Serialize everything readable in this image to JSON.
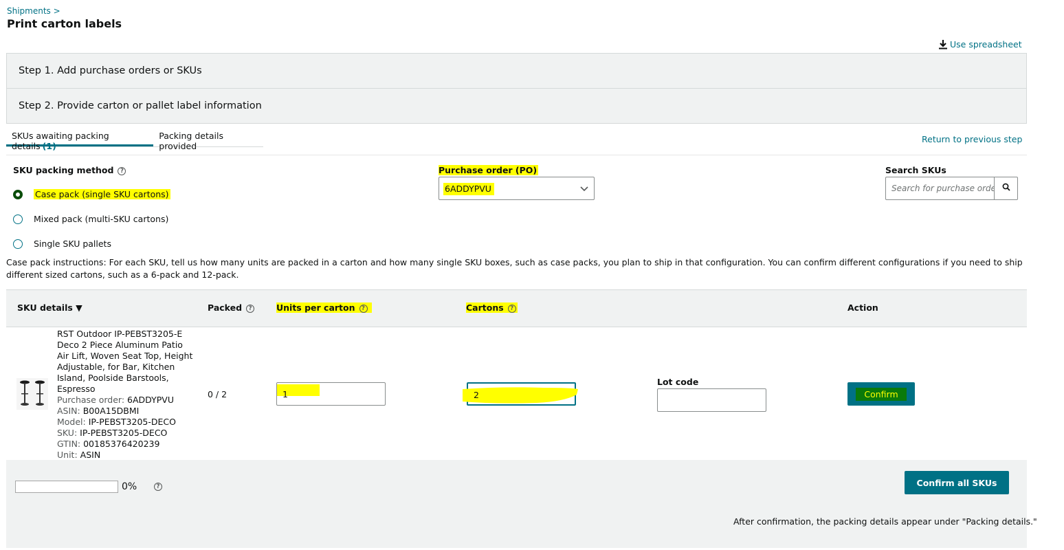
{
  "header": {
    "breadcrumb": "Shipments >",
    "title": "Print carton labels",
    "use_spreadsheet": "Use spreadsheet"
  },
  "steps": [
    {
      "title": "Step 1. Add purchase orders or SKUs"
    },
    {
      "title": "Step 2. Provide carton or pallet label information"
    }
  ],
  "tabs": [
    {
      "label": "SKUs awaiting packing details",
      "count": "(1)",
      "active": true
    },
    {
      "label": "Packing details provided",
      "active": false
    }
  ],
  "return_link": "Return to previous step",
  "packing_method": {
    "label": "SKU packing method",
    "options": [
      {
        "label": "Case pack (single SKU cartons)",
        "selected": true
      },
      {
        "label": "Mixed pack (multi-SKU cartons)",
        "selected": false
      },
      {
        "label": "Single SKU pallets",
        "selected": false
      }
    ]
  },
  "purchase_order": {
    "label": "Purchase order (PO)",
    "value": "6ADDYPVU"
  },
  "search": {
    "label": "Search SKUs",
    "placeholder": "Search for purchase orde"
  },
  "instructions": "Case pack instructions: For each SKU, tell us how many units are packed in a carton and how many single SKU boxes, such as case packs, you plan to ship in that configuration. You can confirm different configurations if you need to ship different sized cartons, such as a 6-pack and 12-pack.",
  "table": {
    "columns": [
      "SKU details ▼",
      "Packed",
      "Units per carton",
      "Cartons",
      "Action"
    ],
    "row": {
      "title": "RST Outdoor IP-PEBST3205-E Deco 2 Piece Aluminum Patio Air Lift, Woven Seat Top, Height Adjustable, for Bar, Kitchen Island, Poolside Barstools, Espresso",
      "po_label": "Purchase order:",
      "po": "6ADDYPVU",
      "asin_label": "ASIN:",
      "asin": "B00A15DBMI",
      "model_label": "Model:",
      "model": "IP-PEBST3205-DECO",
      "sku_label": "SKU:",
      "sku": "IP-PEBST3205-DECO",
      "gtin_label": "GTIN:",
      "gtin": "00185376420239",
      "unit_label": "Unit:",
      "unit": "ASIN",
      "packed": "0 / 2",
      "units_per_carton": "1",
      "cartons": "2",
      "lot_code_label": "Lot code",
      "lot_code": "",
      "confirm": "Confirm"
    }
  },
  "footer": {
    "progress_percent": "0%",
    "progress_value": 0,
    "confirm_all": "Confirm all SKUs",
    "note": "After confirmation, the packing details appear under \"Packing details.\""
  },
  "colors": {
    "accent": "#007185",
    "highlight": "#ffff00",
    "confirm_highlight": "#0a7a0a"
  }
}
